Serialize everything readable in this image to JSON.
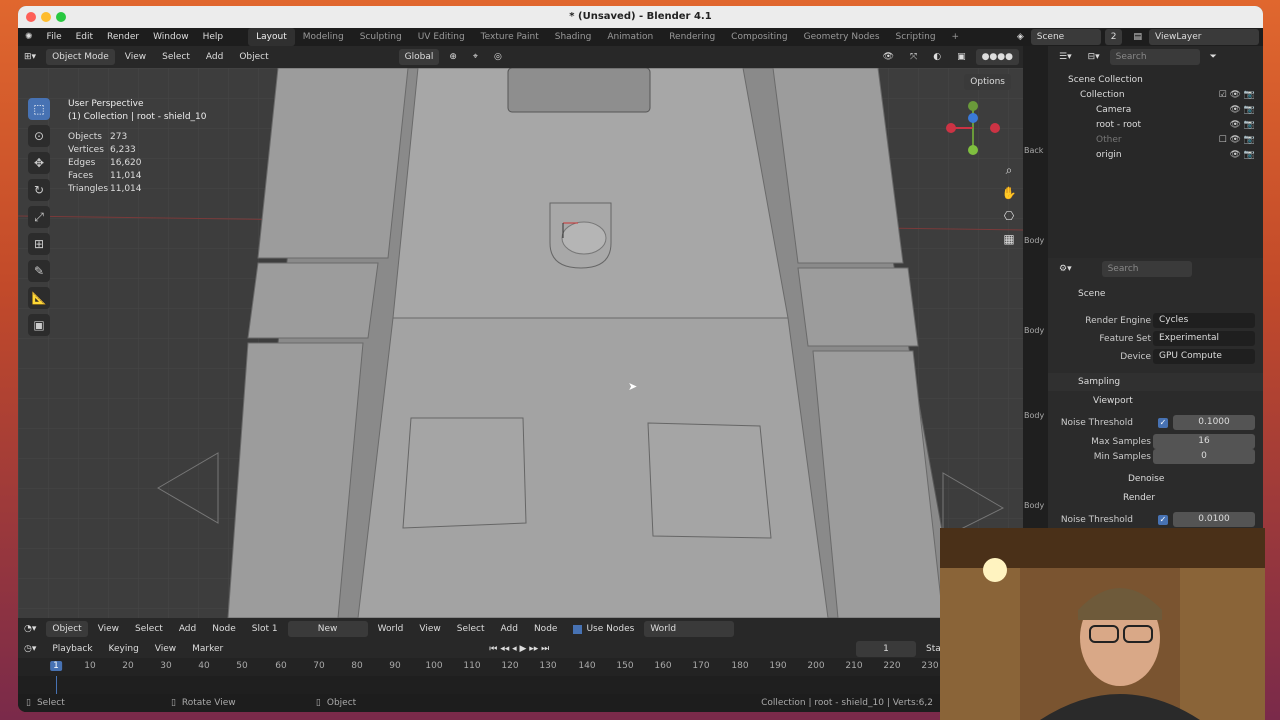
{
  "window": {
    "title": "* (Unsaved) - Blender 4.1"
  },
  "menubar": {
    "items": [
      "File",
      "Edit",
      "Render",
      "Window",
      "Help"
    ],
    "workspaces": [
      "Layout",
      "Modeling",
      "Sculpting",
      "UV Editing",
      "Texture Paint",
      "Shading",
      "Animation",
      "Rendering",
      "Compositing",
      "Geometry Nodes",
      "Scripting"
    ],
    "active_workspace": "Layout",
    "add_tab": "+",
    "scene": "Scene",
    "scene_users": "2",
    "view_layer": "ViewLayer"
  },
  "viewport_header": {
    "mode": "Object Mode",
    "menus": [
      "View",
      "Select",
      "Add",
      "Object"
    ],
    "orientation": "Global",
    "options": "Options"
  },
  "viewport": {
    "perspective": "User Perspective",
    "collection_line": "(1) Collection | root - shield_10",
    "stats": [
      {
        "label": "Objects",
        "value": "273"
      },
      {
        "label": "Vertices",
        "value": "6,233"
      },
      {
        "label": "Edges",
        "value": "16,620"
      },
      {
        "label": "Faces",
        "value": "11,014"
      },
      {
        "label": "Triangles",
        "value": "11,014"
      }
    ]
  },
  "outliner": {
    "search_placeholder": "Search",
    "rows": [
      {
        "label": "Scene Collection"
      },
      {
        "label": "Collection"
      },
      {
        "label": "Camera"
      },
      {
        "label": "root - root"
      },
      {
        "label": "Other"
      },
      {
        "label": "origin"
      }
    ]
  },
  "side_tab_labels": [
    "Back",
    "Body",
    "Body",
    "Body",
    "Body"
  ],
  "properties": {
    "search_placeholder": "Search",
    "context": "Scene",
    "render_engine_label": "Render Engine",
    "render_engine": "Cycles",
    "feature_set_label": "Feature Set",
    "feature_set": "Experimental",
    "device_label": "Device",
    "device": "GPU Compute",
    "sampling": "Sampling",
    "viewport_panel": "Viewport",
    "noise_threshold_label": "Noise Threshold",
    "viewport_noise_threshold": "0.1000",
    "max_samples_label": "Max Samples",
    "max_samples": "16",
    "min_samples_label": "Min Samples",
    "min_samples": "0",
    "denoise": "Denoise",
    "render_panel": "Render",
    "render_noise_threshold": "0.0100"
  },
  "shader_header": {
    "object": "Object",
    "menus": [
      "View",
      "Select",
      "Add",
      "Node"
    ],
    "slot": "Slot 1",
    "new_button": "New",
    "world_type": "World",
    "menus2": [
      "View",
      "Select",
      "Add",
      "Node"
    ],
    "use_nodes": "Use Nodes",
    "world_name": "World"
  },
  "timeline": {
    "menus": [
      "Playback",
      "Keying",
      "View",
      "Marker"
    ],
    "current_frame": "1",
    "start_label": "Start",
    "ticks": [
      "1",
      "10",
      "20",
      "30",
      "40",
      "50",
      "60",
      "70",
      "80",
      "90",
      "100",
      "110",
      "120",
      "130",
      "140",
      "150",
      "160",
      "170",
      "180",
      "190",
      "200",
      "210",
      "220",
      "230"
    ]
  },
  "statusbar": {
    "select": "Select",
    "rotate": "Rotate View",
    "object": "Object",
    "right_info": "Collection | root - shield_10 | Verts:6,2"
  },
  "colors": {
    "accent": "#4772b3",
    "panel": "#282828",
    "viewport_bg": "#3d3d3d"
  }
}
